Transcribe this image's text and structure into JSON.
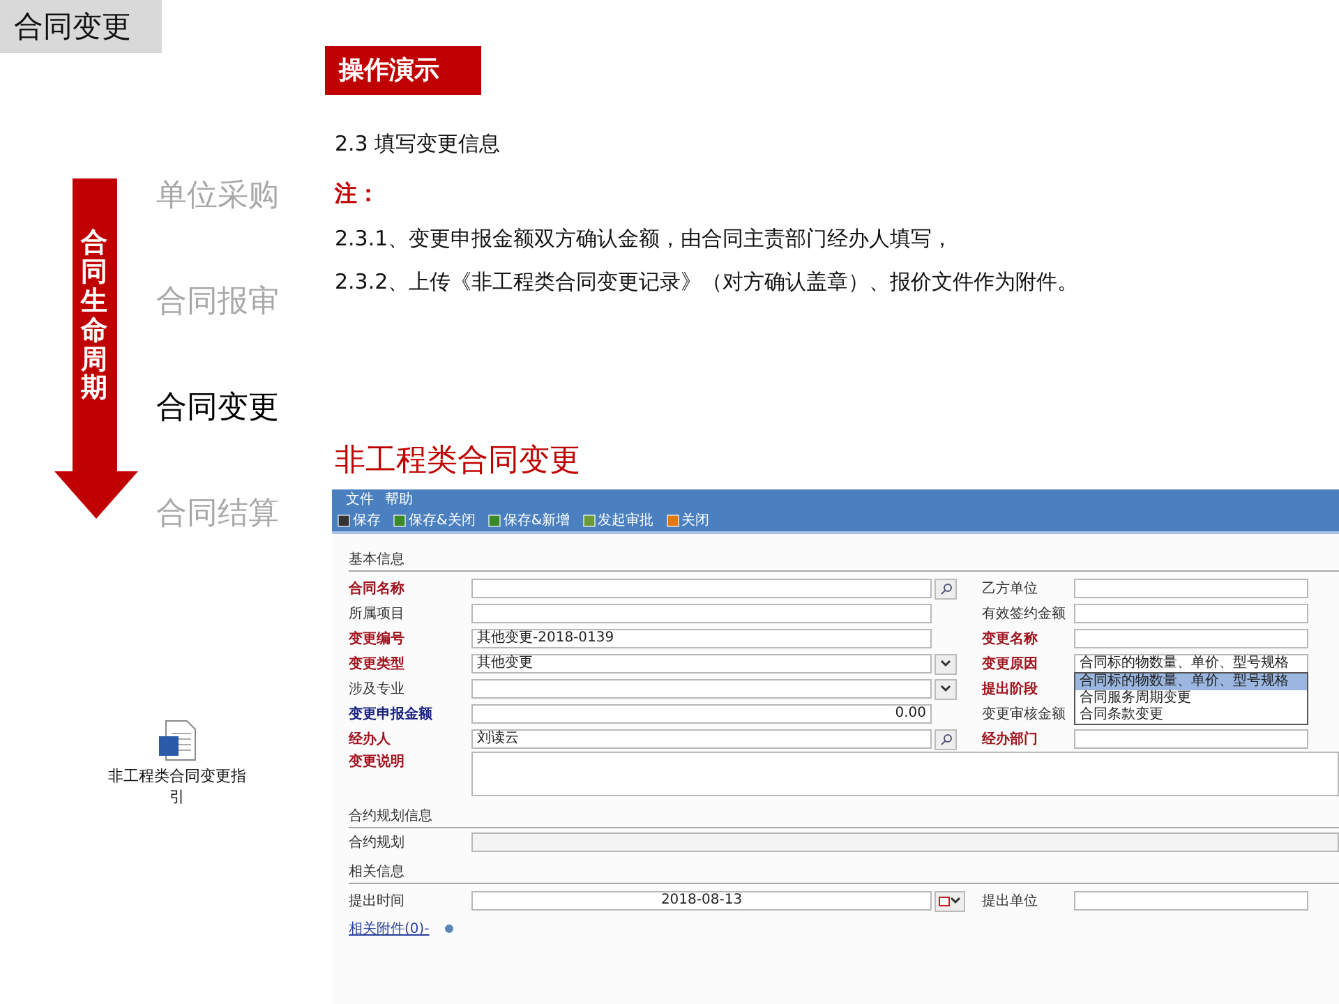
{
  "slide_title": "合同变更",
  "lifecycle": {
    "label": "合同生命周期",
    "stages": [
      {
        "label": "单位采购",
        "selected": false
      },
      {
        "label": "合同报审",
        "selected": false
      },
      {
        "label": "合同变更",
        "selected": true
      },
      {
        "label": "合同结算",
        "selected": false
      }
    ]
  },
  "attachment": {
    "caption": "非工程类合同变更指引"
  },
  "demo_badge": "操作演示",
  "step_title": "2.3 填写变更信息",
  "note_label": "注：",
  "notes": [
    "2.3.1、变更申报金额双方确认金额，由合同主责部门经办人填写，",
    "2.3.2、上传《非工程类合同变更记录》（对方确认盖章）、报价文件作为附件。"
  ],
  "form_heading": "非工程类合同变更",
  "app": {
    "menu": [
      "文件",
      "帮助"
    ],
    "toolbar": [
      "保存",
      "保存&关闭",
      "保存&新增",
      "发起审批",
      "关闭"
    ],
    "sections": [
      {
        "title": "基本信息",
        "rows": [
          {
            "left": {
              "label": "合同名称",
              "required": true,
              "highlighted": false,
              "kind": "lookup"
            },
            "right": {
              "label": "乙方单位",
              "required": false,
              "highlighted": false,
              "kind": "text"
            }
          },
          {
            "left": {
              "label": "所属项目",
              "required": false,
              "highlighted": false,
              "kind": "text"
            },
            "right": {
              "label": "有效签约金额",
              "required": false,
              "highlighted": false,
              "kind": "text"
            }
          },
          {
            "left": {
              "label": "变更编号",
              "required": true,
              "highlighted": false,
              "kind": "text",
              "value": "其他变更-2018-0139"
            },
            "right": {
              "label": "变更名称",
              "required": true,
              "highlighted": false,
              "kind": "text"
            }
          },
          {
            "left": {
              "label": "变更类型",
              "required": true,
              "highlighted": false,
              "kind": "select",
              "value": "其他变更"
            },
            "right": {
              "label": "变更原因",
              "required": true,
              "highlighted": false,
              "kind": "dropdown",
              "value": "合同标的物数量、单价、型号规格",
              "options": [
                {
                  "label": "合同标的物数量、单价、型号规格",
                  "selected": true
                },
                {
                  "label": "合同服务周期变更",
                  "selected": false
                },
                {
                  "label": "合同条款变更",
                  "selected": false
                }
              ]
            }
          },
          {
            "left": {
              "label": "涉及专业",
              "required": false,
              "highlighted": false,
              "kind": "select"
            },
            "right": {
              "label": "提出阶段",
              "required": true,
              "highlighted": false,
              "kind": "covered"
            }
          },
          {
            "left": {
              "label": "变更申报金额",
              "required": true,
              "highlighted": true,
              "kind": "number",
              "value": "0.00"
            },
            "right": {
              "label": "变更审核金额",
              "required": false,
              "highlighted": false,
              "kind": "covered"
            }
          },
          {
            "left": {
              "label": "经办人",
              "required": true,
              "highlighted": false,
              "kind": "lookup",
              "value": "刘读云"
            },
            "right": {
              "label": "经办部门",
              "required": true,
              "highlighted": false,
              "kind": "text"
            }
          },
          {
            "full": {
              "label": "变更说明",
              "required": true,
              "highlighted": false,
              "kind": "textarea"
            }
          }
        ]
      },
      {
        "title": "合约规划信息",
        "rows": [
          {
            "full": {
              "label": "合约规划",
              "required": false,
              "highlighted": false,
              "kind": "readonly"
            }
          }
        ]
      },
      {
        "title": "相关信息",
        "rows": [
          {
            "left": {
              "label": "提出时间",
              "required": false,
              "highlighted": false,
              "kind": "date",
              "value": "2018-08-13"
            },
            "right": {
              "label": "提出单位",
              "required": false,
              "highlighted": false,
              "kind": "text"
            }
          }
        ]
      }
    ],
    "attachments_link": "相关附件(0)-"
  }
}
